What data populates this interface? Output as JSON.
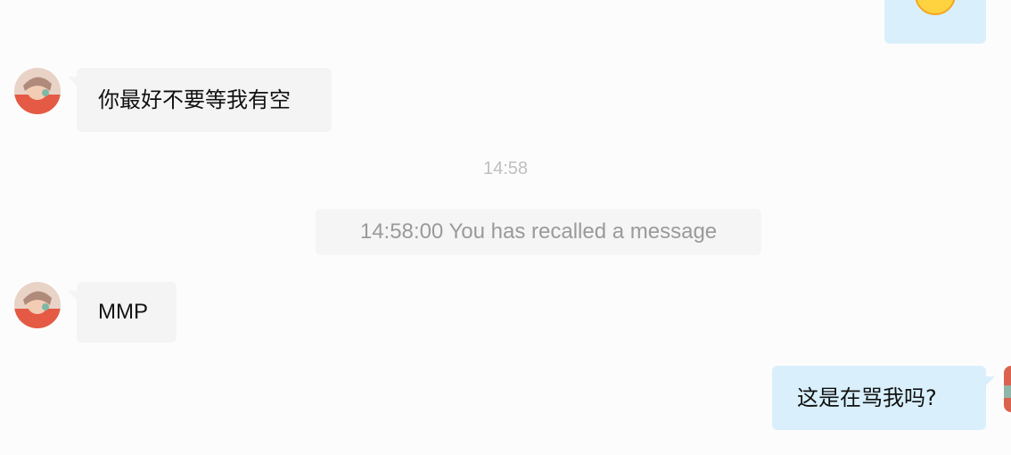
{
  "messages": [
    {
      "id": "m0",
      "direction": "outgoing",
      "content_type": "emoji",
      "emoji": "smiley-face-icon"
    },
    {
      "id": "m1",
      "direction": "incoming",
      "text": "你最好不要等我有空"
    },
    {
      "id": "m2",
      "direction": "incoming",
      "text": "MMP"
    },
    {
      "id": "m3",
      "direction": "outgoing",
      "text": "这是在骂我吗?"
    }
  ],
  "time_divider": "14:58",
  "system_notice": "14:58:00 You has recalled a message",
  "colors": {
    "background": "#fdfcfd",
    "incoming_bubble": "#f4f4f5",
    "outgoing_bubble": "#d9f0fc",
    "time_text": "#bfbfbf",
    "system_text": "#9a9a9a"
  }
}
